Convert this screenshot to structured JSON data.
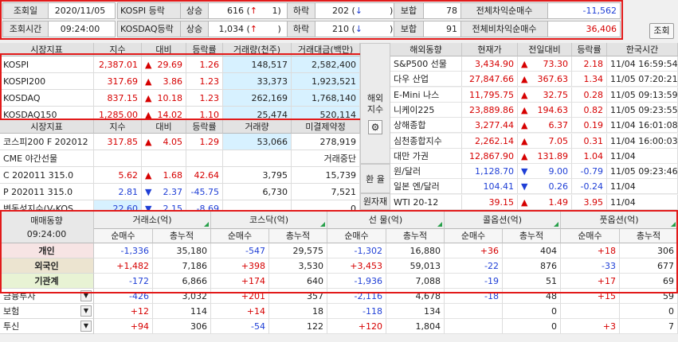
{
  "top": {
    "date_label": "조회일",
    "date": "2020/11/05",
    "time_label": "조회시간",
    "time": "09:24:00",
    "kospi_label": "KOSPI 등락",
    "kosdaq_label": "KOSDAQ등락",
    "up_label": "상승",
    "down_label": "하락",
    "flat_label": "보합",
    "kospi_up": "616",
    "kospi_up_limit": "1",
    "kospi_down": "202",
    "kospi_flat": "78",
    "kosdaq_up": "1,034",
    "kosdaq_down": "210",
    "kosdaq_flat": "91",
    "arbitrage_label": "전체차익순매수",
    "arbitrage": "-11,562",
    "nonarb_label": "전체비차익순매수",
    "nonarb": "36,406",
    "search_button": "조회"
  },
  "market": {
    "headers": [
      "시장지표",
      "지수",
      "대비",
      "등락률",
      "거래량(천주)",
      "거래대금(백만)"
    ],
    "rows": [
      {
        "name": "KOSPI",
        "index": "2,387.01",
        "dir": "▲",
        "change": "29.69",
        "rate": "1.26",
        "volume": "148,517",
        "amount": "2,582,400"
      },
      {
        "name": "KOSPI200",
        "index": "317.69",
        "dir": "▲",
        "change": "3.86",
        "rate": "1.23",
        "volume": "33,373",
        "amount": "1,923,521"
      },
      {
        "name": "KOSDAQ",
        "index": "837.15",
        "dir": "▲",
        "change": "10.18",
        "rate": "1.23",
        "volume": "262,169",
        "amount": "1,768,140"
      },
      {
        "name": "KOSDAQ150",
        "index": "1,285.00",
        "dir": "▲",
        "change": "14.02",
        "rate": "1.10",
        "volume": "25,474",
        "amount": "520,114"
      }
    ]
  },
  "futures": {
    "headers": [
      "시장지표",
      "지수",
      "대비",
      "등락률",
      "거래량",
      "미결제약정"
    ],
    "rows": [
      {
        "name": "코스피200 F 202012",
        "index": "317.85",
        "dir": "▲",
        "change": "4.05",
        "rate": "1.29",
        "volume": "53,066",
        "oi": "278,919",
        "color": "red"
      },
      {
        "name": "CME 야간선물",
        "index": "",
        "dir": "",
        "change": "",
        "rate": "",
        "volume": "",
        "oi": "거래중단",
        "color": "none"
      },
      {
        "name": "C 202011 315.0",
        "index": "5.62",
        "dir": "▲",
        "change": "1.68",
        "rate": "42.64",
        "volume": "3,795",
        "oi": "15,739",
        "color": "red"
      },
      {
        "name": "P 202011 315.0",
        "index": "2.81",
        "dir": "▼",
        "change": "2.37",
        "rate": "-45.75",
        "volume": "6,730",
        "oi": "7,521",
        "color": "blue"
      },
      {
        "name": "변동성지수(V-KOS",
        "index": "22.60",
        "dir": "▼",
        "change": "2.15",
        "rate": "-8.69",
        "volume": "",
        "oi": "0",
        "color": "blue"
      }
    ]
  },
  "side": {
    "overseas": "해외\n지수",
    "fx": "환 율",
    "commodity": "원자재"
  },
  "overseas": {
    "headers": [
      "해외동향",
      "현재가",
      "전일대비",
      "등락률",
      "한국시간"
    ],
    "rows": [
      {
        "name": "S&P500 선물",
        "price": "3,434.90",
        "dir": "▲",
        "change": "73.30",
        "rate": "2.18",
        "date": "11/04",
        "time": "16:59:54",
        "color": "red"
      },
      {
        "name": "다우 산업",
        "price": "27,847.66",
        "dir": "▲",
        "change": "367.63",
        "rate": "1.34",
        "date": "11/05",
        "time": "07:20:21",
        "color": "red"
      },
      {
        "name": "E-Mini 나스",
        "price": "11,795.75",
        "dir": "▲",
        "change": "32.75",
        "rate": "0.28",
        "date": "11/05",
        "time": "09:13:59",
        "color": "red"
      },
      {
        "name": "니케이225",
        "price": "23,889.86",
        "dir": "▲",
        "change": "194.63",
        "rate": "0.82",
        "date": "11/05",
        "time": "09:23:55",
        "color": "red"
      },
      {
        "name": "상해종합",
        "price": "3,277.44",
        "dir": "▲",
        "change": "6.37",
        "rate": "0.19",
        "date": "11/04",
        "time": "16:01:08",
        "color": "red"
      },
      {
        "name": "심천종합지수",
        "price": "2,262.14",
        "dir": "▲",
        "change": "7.05",
        "rate": "0.31",
        "date": "11/04",
        "time": "16:00:03",
        "color": "red"
      },
      {
        "name": "대만 가권",
        "price": "12,867.90",
        "dir": "▲",
        "change": "131.89",
        "rate": "1.04",
        "date": "11/04",
        "time": "",
        "color": "red"
      },
      {
        "name": "원/달러",
        "price": "1,128.70",
        "dir": "▼",
        "change": "9.00",
        "rate": "-0.79",
        "date": "11/05",
        "time": "09:23:46",
        "color": "blue"
      },
      {
        "name": "일본 엔/달러",
        "price": "104.41",
        "dir": "▼",
        "change": "0.26",
        "rate": "-0.24",
        "date": "11/04",
        "time": "",
        "color": "blue"
      },
      {
        "name": "WTI 20-12",
        "price": "39.15",
        "dir": "▲",
        "change": "1.49",
        "rate": "3.95",
        "date": "11/04",
        "time": "",
        "color": "red"
      }
    ]
  },
  "trading": {
    "title": "매매동향",
    "time": "09:24:00",
    "groups": [
      "거래소(억)",
      "코스닥(억)",
      "선 물(억)",
      "콜옵션(억)",
      "풋옵션(억)"
    ],
    "sub": [
      "순매수",
      "총누적"
    ],
    "rows": [
      {
        "name": "개인",
        "vals": [
          "-1,336",
          "35,180",
          "-547",
          "29,575",
          "-1,302",
          "16,880",
          "+36",
          "404",
          "+18",
          "306"
        ],
        "bg": "#f7e4e4"
      },
      {
        "name": "외국인",
        "vals": [
          "+1,482",
          "7,186",
          "+398",
          "3,530",
          "+3,453",
          "59,013",
          "-22",
          "876",
          "-33",
          "677"
        ],
        "bg": "#ece4d0"
      },
      {
        "name": "기관계",
        "vals": [
          "-172",
          "6,866",
          "+174",
          "640",
          "-1,936",
          "7,088",
          "-19",
          "51",
          "+17",
          "69"
        ],
        "bg": "#e8f3d4"
      },
      {
        "name": "금융투자",
        "vals": [
          "-426",
          "3,032",
          "+201",
          "357",
          "-2,116",
          "4,678",
          "-18",
          "48",
          "+15",
          "59"
        ],
        "bg": "#fff"
      },
      {
        "name": "보험",
        "vals": [
          "+12",
          "114",
          "+14",
          "18",
          "-118",
          "134",
          "",
          "0",
          "",
          "0"
        ],
        "bg": "#fff"
      },
      {
        "name": "투신",
        "vals": [
          "+94",
          "306",
          "-54",
          "122",
          "+120",
          "1,804",
          "",
          "0",
          "+3",
          "7"
        ],
        "bg": "#fff"
      }
    ]
  }
}
